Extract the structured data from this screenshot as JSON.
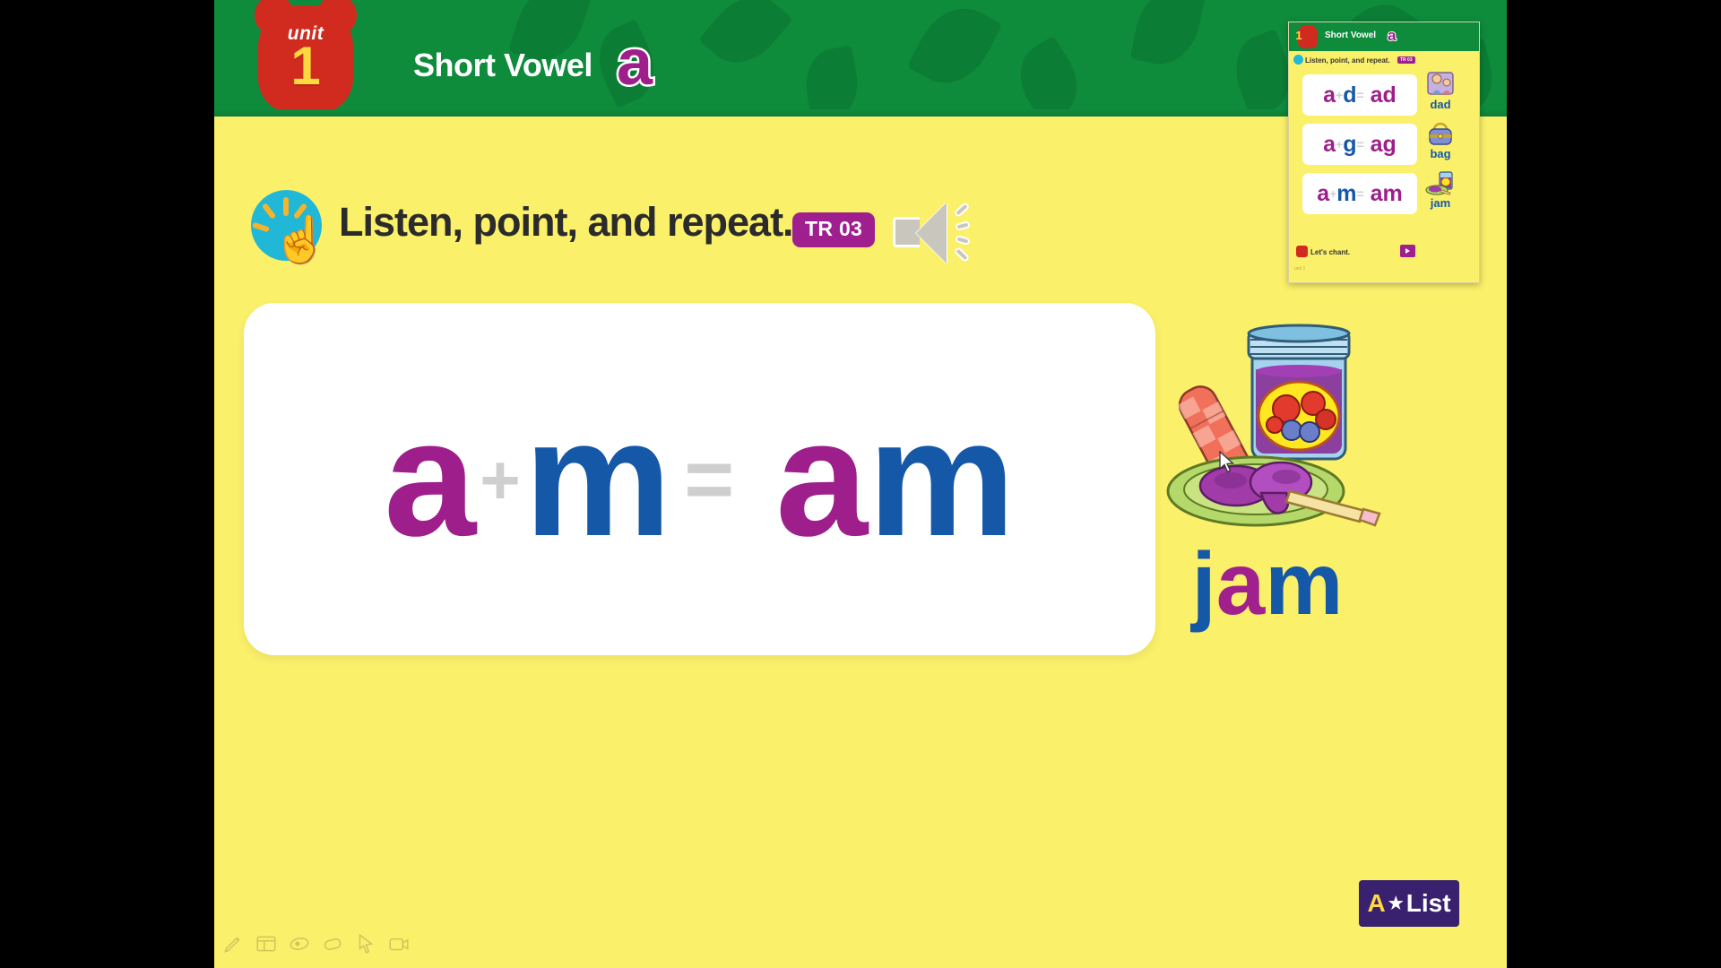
{
  "header": {
    "unit_label": "unit",
    "unit_number": "1",
    "title": "Short Vowel",
    "vowel": "a",
    "bg_color": "#0f8b3c"
  },
  "instruction": {
    "hand_icon": "pointing-hand-icon",
    "text": "Listen, point, and repeat.",
    "track_badge": "TR 03",
    "track_badge_color": "#a01f8f",
    "speaker_icon": "speaker-icon"
  },
  "word_card": {
    "letter_1": "a",
    "operator_plus": "+",
    "letter_2": "m",
    "operator_equals": "=",
    "result_1": "a",
    "result_2": "m",
    "color_vowel": "#9e1f8c",
    "color_consonant": "#1558a8",
    "color_operator": "#cfcfcf"
  },
  "illustration": {
    "image_name": "jam-jar-illustration",
    "word_letter_1": "j",
    "word_letter_2": "a",
    "word_letter_3": "m"
  },
  "thumbnail": {
    "unit_number": "1",
    "title": "Short Vowel",
    "vowel": "a",
    "instruction": "Listen, point, and repeat.",
    "track_badge": "TR 03",
    "rows": [
      {
        "letter_1": "a",
        "plus": "+",
        "letter_2": "d",
        "equals": "=",
        "result": "ad",
        "word": "dad",
        "picture": "dad-icon"
      },
      {
        "letter_1": "a",
        "plus": "+",
        "letter_2": "g",
        "equals": "=",
        "result": "ag",
        "word": "bag",
        "picture": "bag-icon"
      },
      {
        "letter_1": "a",
        "plus": "+",
        "letter_2": "m",
        "equals": "=",
        "result": "am",
        "word": "jam",
        "picture": "jam-icon"
      }
    ],
    "chant_label": "Let's chant.",
    "chant_icon": "robot-icon",
    "video_icon": "video-play-icon",
    "page_label": "unit 1"
  },
  "logo": {
    "letter_a": "A",
    "star": "★",
    "word": "List",
    "bg_color": "#3a2170"
  },
  "toolbar": {
    "tools": [
      {
        "name": "pen-tool",
        "label": "Pen"
      },
      {
        "name": "screen-tool",
        "label": "Screen"
      },
      {
        "name": "highlighter-tool",
        "label": "Highlighter"
      },
      {
        "name": "eraser-tool",
        "label": "Eraser"
      },
      {
        "name": "pointer-tool",
        "label": "Pointer"
      },
      {
        "name": "camera-tool",
        "label": "Camera"
      }
    ]
  }
}
